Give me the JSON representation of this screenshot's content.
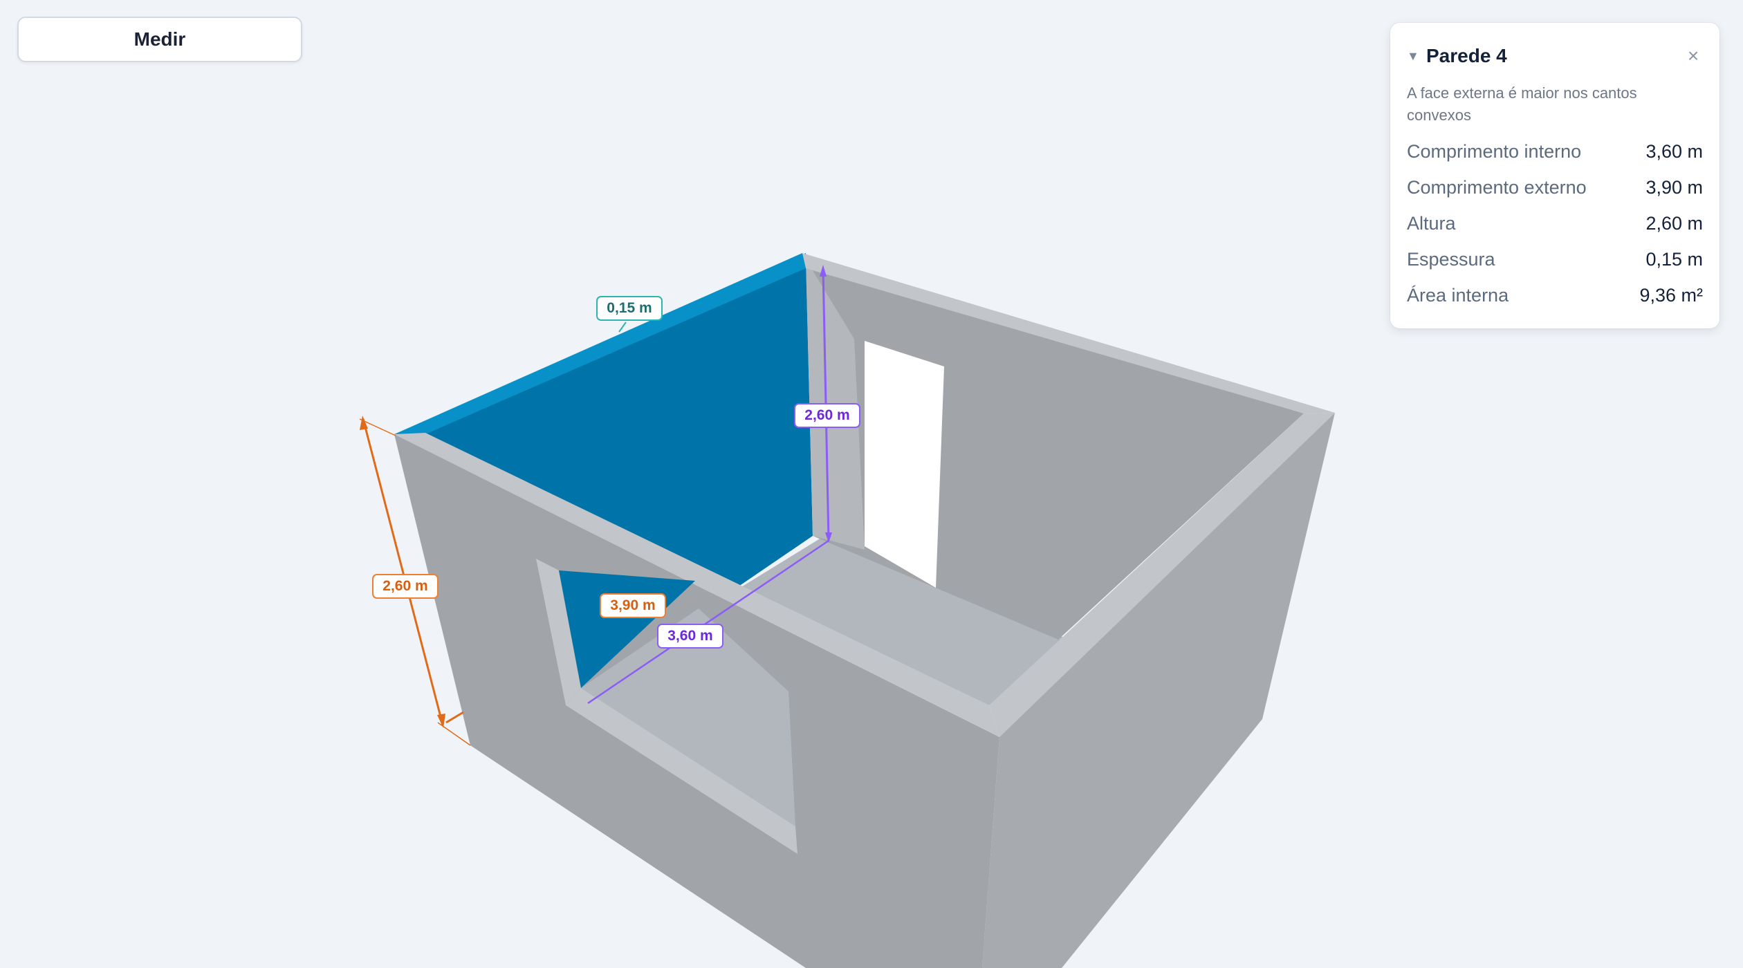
{
  "toolbar": {
    "measure_label": "Medir"
  },
  "panel": {
    "title": "Parede 4",
    "collapse_icon": "chevron-down-icon",
    "close_icon": "close-icon",
    "note": "A face externa é maior nos cantos convexos",
    "rows": [
      {
        "label": "Comprimento interno",
        "value": "3,60 m"
      },
      {
        "label": "Comprimento externo",
        "value": "3,90 m"
      },
      {
        "label": "Altura",
        "value": "2,60 m"
      },
      {
        "label": "Espessura",
        "value": "0,15 m"
      },
      {
        "label": "Área interna",
        "value": "9,36 m²"
      }
    ]
  },
  "dimensions": {
    "thickness": "0,15 m",
    "inner_height": "2,60 m",
    "outer_height": "2,60 m",
    "outer_length": "3,90 m",
    "inner_length": "3,60 m"
  },
  "colors": {
    "background": "#f0f4f8",
    "selected_wall": "#0073a8",
    "selected_wall_top": "#0891c8",
    "wall": "#a2a5aa",
    "wall_top": "#c2c5c9",
    "floor": "#b2b7be",
    "thickness_dim": "#2bb5b0",
    "inner_dim": "#8b5cf6",
    "outer_dim": "#ef7f2f"
  }
}
